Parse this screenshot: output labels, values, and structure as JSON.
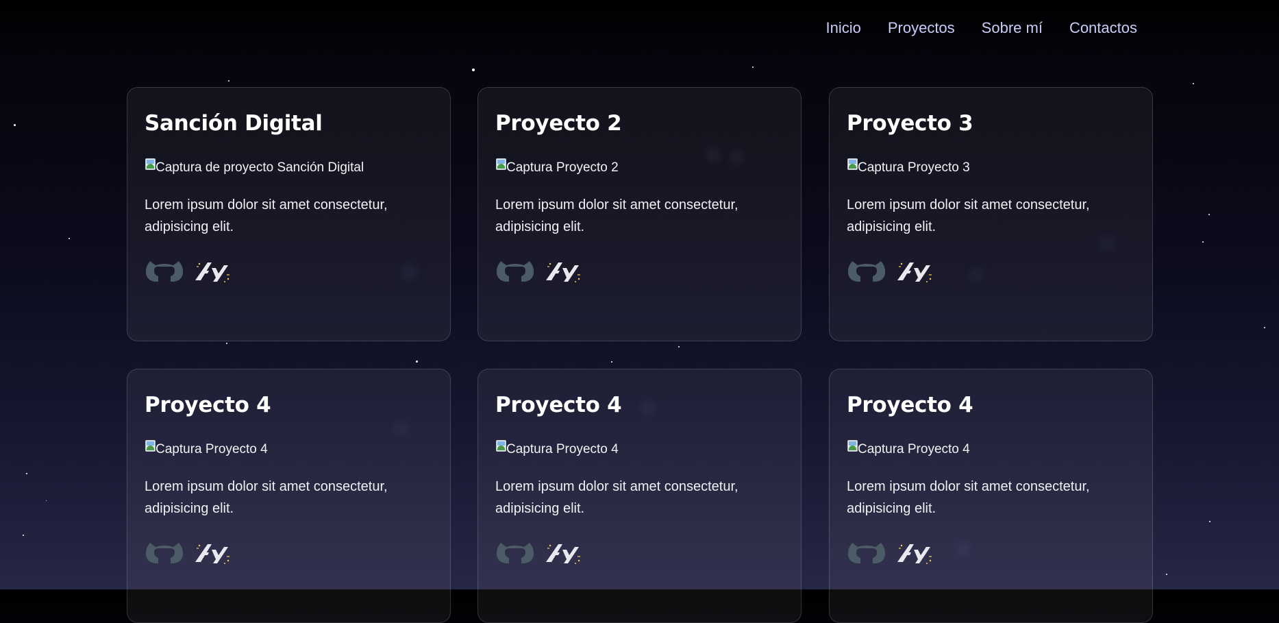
{
  "nav": {
    "links": [
      {
        "label": "Inicio"
      },
      {
        "label": "Proyectos"
      },
      {
        "label": "Sobre mí"
      },
      {
        "label": "Contactos"
      }
    ]
  },
  "projects": [
    {
      "title": "Sanción Digital",
      "image_alt": "Captura de proyecto Sanción Digital",
      "description": "Lorem ipsum dolor sit amet consectetur, adipisicing elit."
    },
    {
      "title": "Proyecto 2",
      "image_alt": "Captura Proyecto 2",
      "description": "Lorem ipsum dolor sit amet consectetur, adipisicing elit."
    },
    {
      "title": "Proyecto 3",
      "image_alt": "Captura Proyecto 3",
      "description": "Lorem ipsum dolor sit amet consectetur, adipisicing elit."
    },
    {
      "title": "Proyecto 4",
      "image_alt": "Captura Proyecto 4",
      "description": "Lorem ipsum dolor sit amet consectetur, adipisicing elit."
    },
    {
      "title": "Proyecto 4",
      "image_alt": "Captura Proyecto 4",
      "description": "Lorem ipsum dolor sit amet consectetur, adipisicing elit."
    },
    {
      "title": "Proyecto 4",
      "image_alt": "Captura Proyecto 4",
      "description": "Lorem ipsum dolor sit amet consectetur, adipisicing elit."
    }
  ],
  "icons": {
    "repo": "github-icon",
    "demo": "deploy-icon"
  },
  "colors": {
    "nav_link": "#c9cdf8",
    "github_icon": "#4b5c67",
    "card_border": "rgba(255,255,255,0.16)"
  }
}
